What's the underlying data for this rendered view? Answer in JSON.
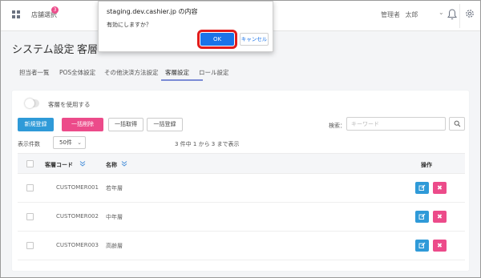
{
  "header": {
    "store_select": "店舗選択",
    "badge_count": "3",
    "user_role": "管理者",
    "user_name": "太郎",
    "user_chevron": "⌄"
  },
  "page": {
    "title": "システム設定",
    "separator": "〉",
    "subtitle": "客層"
  },
  "tabs": [
    {
      "label": "担当者一覧"
    },
    {
      "label": "POS全体設定"
    },
    {
      "label": "その他決済方法設定"
    },
    {
      "label": "客層設定",
      "active": true
    },
    {
      "label": "ロール設定"
    }
  ],
  "controls": {
    "toggle_label": "客層を使用する",
    "new_button": "新規登録",
    "bulk_delete_button": "一括削除",
    "bulk_get_button": "一括取得",
    "bulk_register_button": "一括登録",
    "search_label": "検索：",
    "search_placeholder": "キーワード",
    "per_page_label": "表示件数",
    "per_page_value": "50件",
    "count_text": "3 件中 1 から 3 まで表示"
  },
  "table": {
    "headers": {
      "code": "客層コード",
      "name": "名称",
      "actions": "操作"
    },
    "rows": [
      {
        "code": "CUSTOMER001",
        "name": "若年層"
      },
      {
        "code": "CUSTOMER002",
        "name": "中年層"
      },
      {
        "code": "CUSTOMER003",
        "name": "高齢層"
      }
    ],
    "delete_glyph": "✖"
  },
  "dialog": {
    "title": "staging.dev.cashier.jp の内容",
    "message": "有効にしますか？",
    "ok_label": "OK",
    "cancel_label": "キャンセル"
  },
  "colors": {
    "primary": "#2f9ad8",
    "danger": "#ec4b8a",
    "dialog_ok": "#1a73e8",
    "highlight_ring": "#e11b1b",
    "active_tab": "#7b8bd6"
  },
  "icons": [
    "grid-icon",
    "bell-icon",
    "gear-icon",
    "search-icon",
    "sort-icon",
    "edit-icon",
    "delete-icon",
    "chevron-down-icon"
  ]
}
